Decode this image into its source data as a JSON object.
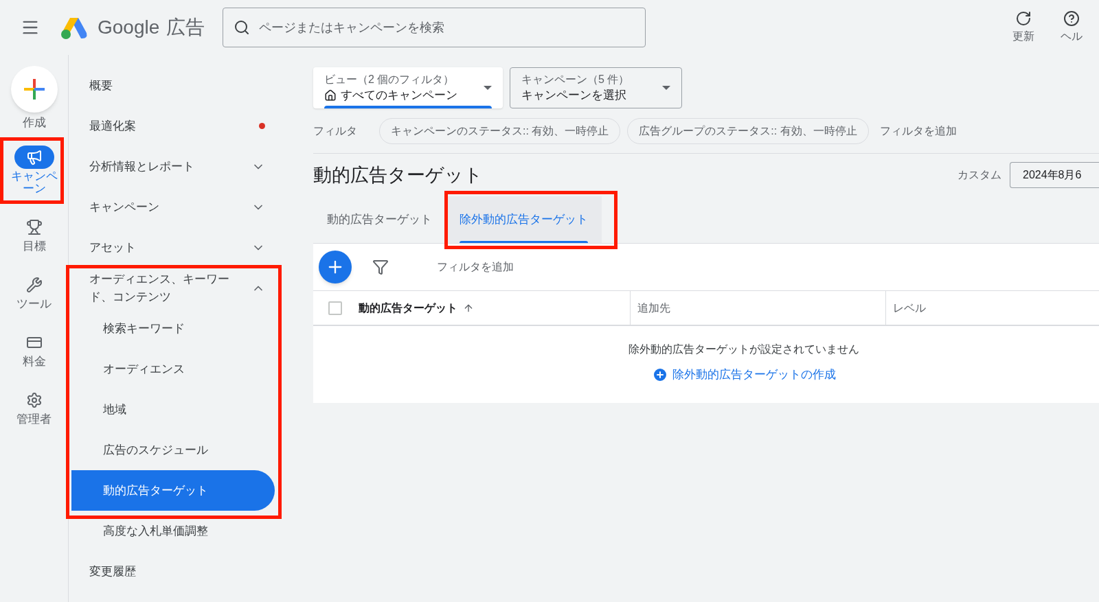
{
  "header": {
    "brand": "Google",
    "product": "広告",
    "search": {
      "placeholder": "ページまたはキャンペーンを検索"
    },
    "actions": [
      {
        "kind": "refresh",
        "label": "更新"
      },
      {
        "kind": "help",
        "label": "ヘル"
      }
    ]
  },
  "rail": {
    "items": [
      {
        "kind": "create",
        "label": "作成"
      },
      {
        "kind": "campaign",
        "label": "キャンペーン",
        "selected": true
      },
      {
        "kind": "goal",
        "label": "目標",
        "selected": false
      },
      {
        "kind": "tools",
        "label": "ツール",
        "selected": false
      },
      {
        "kind": "billing",
        "label": "料金",
        "selected": false
      },
      {
        "kind": "admin",
        "label": "管理者",
        "selected": false
      }
    ]
  },
  "nav": {
    "items": [
      {
        "kind": "link",
        "label": "概要",
        "notification": false,
        "selected": false
      },
      {
        "kind": "link",
        "label": "最適化案",
        "notification": true,
        "selected": false
      },
      {
        "kind": "group",
        "label": "分析情報とレポート",
        "notification": false,
        "selected": false,
        "expanded": false
      },
      {
        "kind": "group",
        "label": "キャンペーン",
        "notification": false,
        "selected": false,
        "expanded": false
      },
      {
        "kind": "group",
        "label": "アセット",
        "notification": false,
        "selected": false,
        "expanded": false
      },
      {
        "kind": "group",
        "label": "オーディエンス、キーワード、コンテンツ",
        "notification": false,
        "selected": false,
        "expanded": true,
        "children": [
          {
            "label": "検索キーワード",
            "selected": false
          },
          {
            "label": "オーディエンス",
            "selected": false
          },
          {
            "label": "地域",
            "selected": false
          },
          {
            "label": "広告のスケジュール",
            "selected": false
          },
          {
            "label": "動的広告ターゲット",
            "selected": true
          },
          {
            "label": "高度な入札単価調整",
            "selected": false
          }
        ]
      },
      {
        "kind": "link",
        "label": "変更履歴",
        "notification": false,
        "selected": false
      }
    ]
  },
  "selectors": [
    {
      "kind": "view",
      "label": "ビュー（2 個のフィルタ）",
      "value": "すべてのキャンペーン"
    },
    {
      "kind": "campaign",
      "label": "キャンペーン（5 件）",
      "value": "キャンペーンを選択"
    }
  ],
  "filters": {
    "label": "フィルタ",
    "chips": [
      "キャンペーンのステータス:: 有効、一時停止",
      "広告グループのステータス:: 有効、一時停止"
    ],
    "add": "フィルタを追加"
  },
  "page": {
    "title": "動的広告ターゲット",
    "date_label": "カスタム",
    "date_value": "2024年8月6"
  },
  "tabs": [
    {
      "label": "動的広告ターゲット",
      "selected": false
    },
    {
      "label": "除外動的広告ターゲット",
      "selected": true
    }
  ],
  "toolbar": {
    "add_filter": "フィルタを追加"
  },
  "table": {
    "select_all_checked": false,
    "columns": [
      {
        "label": "動的広告ターゲット",
        "sorted": true
      },
      {
        "label": "追加先",
        "sorted": false
      },
      {
        "label": "レベル",
        "sorted": false
      }
    ],
    "empty_message": "除外動的広告ターゲットが設定されていません",
    "create_link": "除外動的広告ターゲットの作成"
  }
}
